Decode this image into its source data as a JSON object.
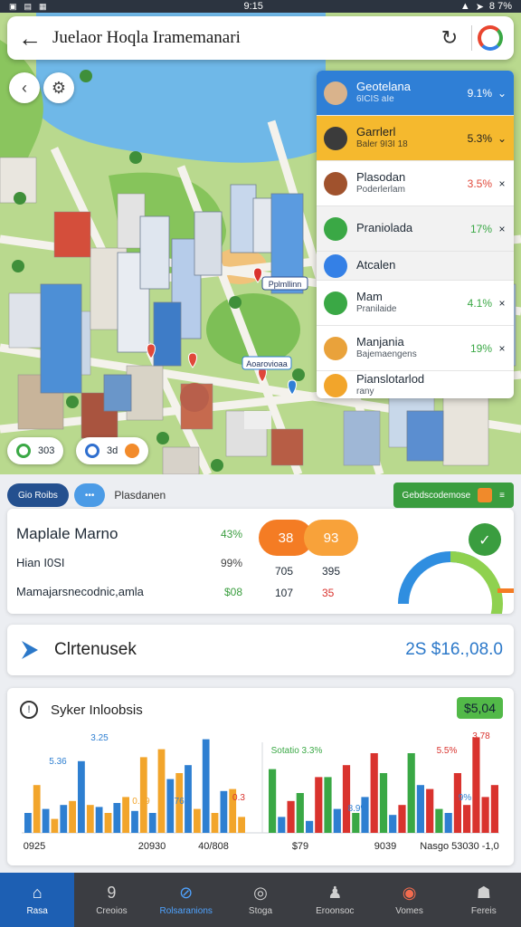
{
  "status_bar": {
    "time": "9:15",
    "battery": "8 7%"
  },
  "search": {
    "title": "Juelaor Hoqla Iramemanari"
  },
  "places": [
    {
      "name": "Geotelana",
      "sub": "6ICIS aIe",
      "value": "9.1%",
      "indicator": "chevron-down",
      "color": "#2f7fd6"
    },
    {
      "name": "Garrlerl",
      "sub": "Baler 9I3I 18",
      "value": "5.3%",
      "indicator": "chevron-down",
      "color": "#f5b92e"
    },
    {
      "name": "Plasodan",
      "sub": "Poderlerlam",
      "value": "3.5%",
      "indicator": "x",
      "valueColor": "#e0483a"
    },
    {
      "name": "Praniolada",
      "sub": "",
      "value": "17%",
      "indicator": "x",
      "valueColor": "#3aa845"
    },
    {
      "name": "Atcalen",
      "sub": "",
      "value": "",
      "indicator": ""
    },
    {
      "name": "Mam",
      "sub": "Pranilaide",
      "value": "4.1%",
      "indicator": "x",
      "valueColor": "#3aa845"
    },
    {
      "name": "Manjania",
      "sub": "Bajemaengens",
      "value": "19%",
      "indicator": "x",
      "valueColor": "#3aa845"
    },
    {
      "name": "Pianslotarlod",
      "sub": "rany",
      "value": "",
      "indicator": ""
    }
  ],
  "map_labels": {
    "pin1": "Pplmllinn",
    "pin2": "Aoarovioaa"
  },
  "map_chips": {
    "chip1": "303",
    "chip2": "3d"
  },
  "tabs": {
    "tab1": "Gio Roibs",
    "tab2": "•••",
    "label": "Plasdanen",
    "green": "Gebdscodemose"
  },
  "stats": {
    "rows": [
      {
        "label": "Maplale Marno",
        "pct": "43%"
      },
      {
        "label": "Hian I0SI",
        "pct": "99%"
      },
      {
        "label": "Mamajarsnecodnic,amla",
        "pct": "$08"
      }
    ],
    "bubble_left": "38",
    "bubble_right": "93",
    "nums": [
      [
        "705",
        "395"
      ],
      [
        "107",
        "35"
      ]
    ]
  },
  "summary": {
    "title": "Clrtenusek",
    "value": "2S $16.,08.0"
  },
  "chart_data": {
    "type": "bar",
    "title": "Syker Inloobsis",
    "badge": "$5,04",
    "x_tick_labels": [
      "0925",
      "20930",
      "40/808",
      "$79",
      "9039",
      "Nasgo 53030 -1,0"
    ],
    "annotations": [
      "5.36",
      "3.25",
      "0.39",
      "7.76",
      "0.3",
      "Sotatio 3.3%",
      "8.9%",
      "5.5%",
      "3.78",
      "9%"
    ],
    "groups": [
      {
        "color": "#2e7fd1",
        "values": [
          10,
          12,
          14,
          36,
          13,
          15,
          11,
          10,
          27,
          34,
          47,
          21
        ]
      },
      {
        "color": "#f2a52b",
        "values": [
          24,
          7,
          16,
          14,
          10,
          18,
          38,
          42,
          30,
          12,
          10,
          22,
          8
        ]
      },
      {
        "color": "#3aa845",
        "values": [
          32,
          20,
          28,
          10,
          30,
          40,
          12
        ]
      },
      {
        "color": "#2e7fd1",
        "values": [
          8,
          6,
          12,
          18,
          9,
          24,
          10
        ]
      },
      {
        "color": "#d9332e",
        "values": [
          16,
          28,
          34,
          40,
          14,
          22,
          30,
          14,
          48,
          18,
          24
        ]
      }
    ]
  },
  "nav": [
    {
      "label": "Rasa",
      "icon": "⌂"
    },
    {
      "label": "Creoios",
      "icon": "9"
    },
    {
      "label": "Rolsaranions",
      "icon": "⊘"
    },
    {
      "label": "Stoga",
      "icon": "◎"
    },
    {
      "label": "Eroonsoc",
      "icon": "♟"
    },
    {
      "label": "Vomes",
      "icon": "◉"
    },
    {
      "label": "Fereis",
      "icon": "☗"
    }
  ]
}
